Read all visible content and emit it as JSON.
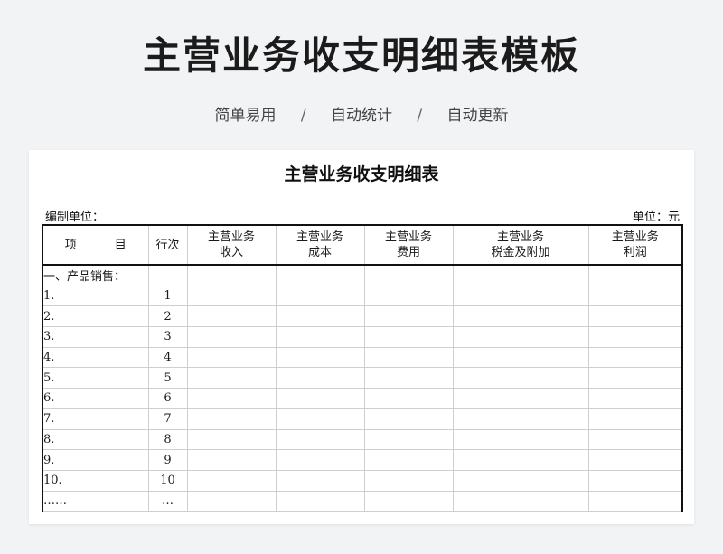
{
  "page": {
    "title": "主营业务收支明细表模板",
    "features": [
      "简单易用",
      "自动统计",
      "自动更新"
    ],
    "separator": "/"
  },
  "sheet": {
    "title": "主营业务收支明细表",
    "unit_left": "编制单位：",
    "unit_right": "单位：元",
    "headers": {
      "item_a": "项",
      "item_b": "目",
      "seq": "行次",
      "cols": [
        {
          "l1": "主营业务",
          "l2": "收入"
        },
        {
          "l1": "主营业务",
          "l2": "成本"
        },
        {
          "l1": "主营业务",
          "l2": "费用"
        },
        {
          "l1": "主营业务",
          "l2": "税金及附加"
        },
        {
          "l1": "主营业务",
          "l2": "利润"
        }
      ]
    },
    "section": "一、产品销售：",
    "rows": [
      {
        "item": "1.",
        "seq": "1"
      },
      {
        "item": "2.",
        "seq": "2"
      },
      {
        "item": "3.",
        "seq": "3"
      },
      {
        "item": "4.",
        "seq": "4"
      },
      {
        "item": "5.",
        "seq": "5"
      },
      {
        "item": "6.",
        "seq": "6"
      },
      {
        "item": "7.",
        "seq": "7"
      },
      {
        "item": "8.",
        "seq": "8"
      },
      {
        "item": "9.",
        "seq": "9"
      },
      {
        "item": "10.",
        "seq": "10"
      },
      {
        "item": "……",
        "seq": "…"
      }
    ]
  }
}
